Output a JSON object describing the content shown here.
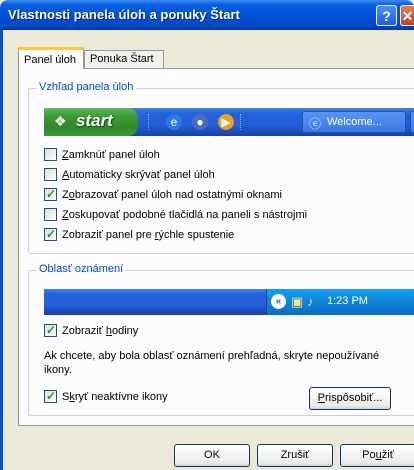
{
  "window": {
    "title": "Vlastnosti panela úloh a ponuky Štart",
    "help_icon": "help-icon",
    "close_icon": "close-icon"
  },
  "tabs": [
    {
      "label": "Panel úloh",
      "active": true
    },
    {
      "label": "Ponuka Štart",
      "active": false
    }
  ],
  "taskbar_group": {
    "label": "Vzhľad panela úloh",
    "preview": {
      "start_label": "start",
      "task_label": "Welcome..."
    },
    "options": [
      {
        "pre": "",
        "acc": "Z",
        "post": "amknúť panel úloh",
        "checked": false
      },
      {
        "pre": "",
        "acc": "A",
        "post": "utomaticky skrývať panel úloh",
        "checked": false
      },
      {
        "pre": "Z",
        "acc": "o",
        "post": "brazovať panel úloh nad ostatnými oknami",
        "checked": true
      },
      {
        "pre": "",
        "acc": "Z",
        "post": "oskupovať podobné tlačidlá na paneli s nástrojmi",
        "checked": false
      },
      {
        "pre": "Zobraziť panel pre ",
        "acc": "r",
        "post": "ýchle spustenie",
        "checked": true
      }
    ]
  },
  "notification_group": {
    "label": "Oblasť oznámení",
    "preview": {
      "clock": "1:23 PM"
    },
    "show_clock": {
      "pre": "Zobraziť ",
      "acc": "h",
      "post": "odiny",
      "checked": true
    },
    "info_text": "Ak chcete, aby bola oblasť oznámení prehľadná, skryte nepoužívané ikony.",
    "hide_inactive": {
      "pre": "S",
      "acc": "k",
      "post": "ryť neaktívne ikony",
      "checked": true
    },
    "customize": {
      "acc": "P",
      "post": "rispôsobiť..."
    }
  },
  "footer": {
    "ok": "OK",
    "cancel": "Zrušiť",
    "apply": {
      "pre": "Po",
      "acc": "u",
      "post": "žiť"
    }
  },
  "colors": {
    "title_bar": "#0453d8",
    "group_label": "#0046d5",
    "checkmark": "#21a121",
    "dialog_bg": "#ece9d8",
    "tab_highlight": "#ffc83c"
  }
}
